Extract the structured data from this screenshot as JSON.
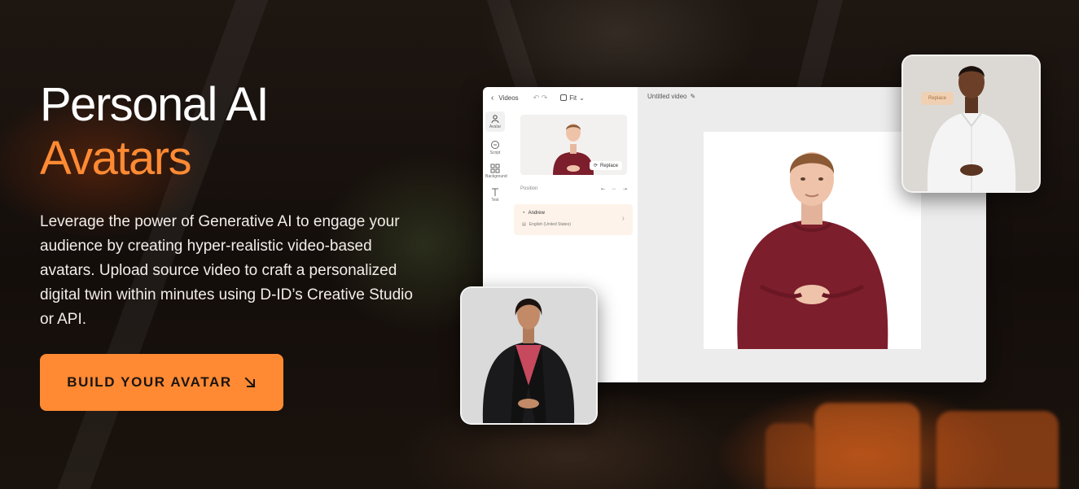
{
  "hero": {
    "title_line1": "Personal AI",
    "title_line2": "Avatars",
    "description": "Leverage the power of Generative AI to engage your audience by creating hyper-realistic video-based avatars. Upload source video to craft a personalized digital twin within minutes using D-ID’s Creative Studio or API.",
    "cta_label": "BUILD YOUR AVATAR"
  },
  "studio": {
    "back_label": "Videos",
    "fit_label": "Fit",
    "video_title": "Untitled video",
    "tools": [
      {
        "label": "Avatar",
        "icon": "avatar-icon"
      },
      {
        "label": "Script",
        "icon": "script-icon"
      },
      {
        "label": "Background",
        "icon": "background-icon"
      },
      {
        "label": "Text",
        "icon": "text-icon"
      }
    ],
    "replace_label": "Replace",
    "position_label": "Position",
    "voice": {
      "name": "Andrew",
      "language": "English (United States)"
    }
  },
  "floating_cards": {
    "man_button_label": "Replace"
  },
  "colors": {
    "accent": "#ff8a33",
    "sweater": "#7d1e2c",
    "voice_card_bg": "#fdf3ea"
  }
}
